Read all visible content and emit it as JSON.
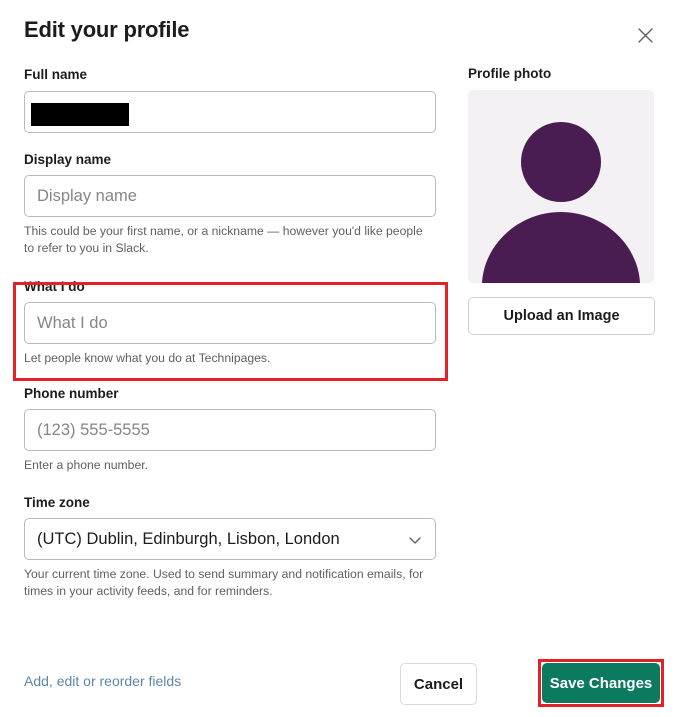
{
  "dialog": {
    "title": "Edit your profile",
    "close_icon": "close-icon"
  },
  "fields": {
    "full_name": {
      "label": "Full name",
      "value": "",
      "placeholder": "",
      "redacted": true
    },
    "display_name": {
      "label": "Display name",
      "value": "",
      "placeholder": "Display name",
      "help": "This could be your first name, or a nickname — however you'd like people to refer to you in Slack."
    },
    "what_i_do": {
      "label": "What I do",
      "value": "",
      "placeholder": "What I do",
      "help": "Let people know what you do at Technipages.",
      "highlighted": true
    },
    "phone_number": {
      "label": "Phone number",
      "value": "",
      "placeholder": "(123) 555-5555",
      "help": "Enter a phone number."
    },
    "time_zone": {
      "label": "Time zone",
      "selected": "(UTC) Dublin, Edinburgh, Lisbon, London",
      "help": "Your current time zone. Used to send summary and notification emails, for times in your activity feeds, and for reminders.",
      "chevron_icon": "chevron-down-icon"
    }
  },
  "profile_photo": {
    "label": "Profile photo",
    "avatar_icon": "person-avatar-icon",
    "avatar_color": "#4a1d52",
    "avatar_bg": "#f3f1f3",
    "upload_label": "Upload an Image"
  },
  "footer": {
    "fields_link": "Add, edit or reorder fields",
    "cancel_label": "Cancel",
    "save_label": "Save Changes",
    "save_color": "#0b7a5f"
  },
  "annotations": {
    "highlight_color": "#e32227",
    "boxes": [
      "what-i-do-section",
      "save-changes-button"
    ]
  }
}
